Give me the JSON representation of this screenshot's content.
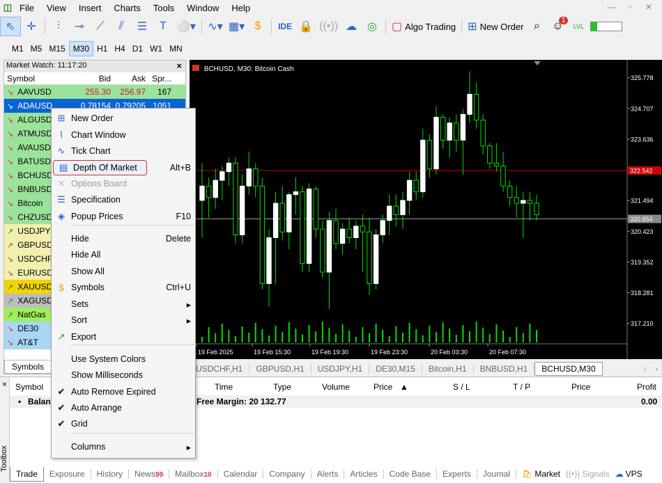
{
  "menubar": {
    "items": [
      "File",
      "View",
      "Insert",
      "Charts",
      "Tools",
      "Window",
      "Help"
    ],
    "window_controls": "— ▫ ✕"
  },
  "toolbar": {
    "ide_label": "IDE",
    "algo_trading_label": "Algo Trading",
    "new_order_label": "New Order",
    "notification_count": "1",
    "level_label": "LVL"
  },
  "timeframes": [
    "M1",
    "M5",
    "M15",
    "M30",
    "H1",
    "H4",
    "D1",
    "W1",
    "MN"
  ],
  "timeframe_selected": "M30",
  "market_watch": {
    "title": "Market Watch: 11:17:20",
    "close": "×",
    "headers": {
      "symbol": "Symbol",
      "bid": "Bid",
      "ask": "Ask",
      "spread": "Spr..."
    },
    "rows": [
      {
        "symbol": "AAVUSD",
        "bid": "255.30",
        "ask": "256.97",
        "spread": "167",
        "bg": "#9be39b",
        "arrow": "↘"
      },
      {
        "symbol": "ADAUSD",
        "bid": "0.78154",
        "ask": "0.79205",
        "spread": "1051",
        "bg": "#0a64d2",
        "arrow": "↘"
      },
      {
        "symbol": "ALGUSD",
        "bid": "",
        "ask": "",
        "spread": "",
        "bg": "#9be39b",
        "arrow": "↘"
      },
      {
        "symbol": "ATMUSD",
        "bid": "",
        "ask": "",
        "spread": "",
        "bg": "#9be39b",
        "arrow": "↘"
      },
      {
        "symbol": "AVAUSD",
        "bid": "",
        "ask": "",
        "spread": "",
        "bg": "#9be39b",
        "arrow": "↘"
      },
      {
        "symbol": "BATUSD",
        "bid": "",
        "ask": "",
        "spread": "",
        "bg": "#9be39b",
        "arrow": "↘"
      },
      {
        "symbol": "BCHUSD",
        "bid": "",
        "ask": "",
        "spread": "",
        "bg": "#9be39b",
        "arrow": "↘"
      },
      {
        "symbol": "BNBUSD",
        "bid": "",
        "ask": "",
        "spread": "",
        "bg": "#9be39b",
        "arrow": "↘"
      },
      {
        "symbol": "Bitcoin",
        "bid": "",
        "ask": "",
        "spread": "",
        "bg": "#9be39b",
        "arrow": "↘"
      },
      {
        "symbol": "CHZUSD",
        "bid": "",
        "ask": "",
        "spread": "",
        "bg": "#9be39b",
        "arrow": "↘"
      },
      {
        "symbol": "USDJPY",
        "bid": "",
        "ask": "",
        "spread": "",
        "bg": "#f3efb0",
        "arrow": "↗"
      },
      {
        "symbol": "GBPUSD",
        "bid": "",
        "ask": "",
        "spread": "",
        "bg": "#f3efb0",
        "arrow": "↗"
      },
      {
        "symbol": "USDCHF",
        "bid": "",
        "ask": "",
        "spread": "",
        "bg": "#f3efb0",
        "arrow": "↘"
      },
      {
        "symbol": "EURUSD",
        "bid": "",
        "ask": "",
        "spread": "",
        "bg": "#f3efb0",
        "arrow": "↘"
      },
      {
        "symbol": "XAUUSD",
        "bid": "",
        "ask": "",
        "spread": "",
        "bg": "#f3d400",
        "arrow": "↗"
      },
      {
        "symbol": "XAGUSD",
        "bid": "",
        "ask": "",
        "spread": "",
        "bg": "#bdbdbd",
        "arrow": "↗"
      },
      {
        "symbol": "NatGas",
        "bid": "",
        "ask": "",
        "spread": "",
        "bg": "#9fee5a",
        "arrow": "↗"
      },
      {
        "symbol": "DE30",
        "bid": "",
        "ask": "",
        "spread": "",
        "bg": "#a9d6f5",
        "arrow": "↘"
      },
      {
        "symbol": "AT&T",
        "bid": "",
        "ask": "",
        "spread": "",
        "bg": "#a9d6f5",
        "arrow": "↘"
      }
    ],
    "tab_label": "Symbols"
  },
  "chart": {
    "title": "BCHUSD, M30:  Bitcoin Cash",
    "price_labels": [
      "325.778",
      "324.707",
      "323.636",
      "322.542",
      "321.494",
      "320.854",
      "320.423",
      "319.352",
      "318.281",
      "317.210"
    ],
    "time_labels": [
      "19 Feb 2025",
      "19 Feb 15:30",
      "19 Feb 19:30",
      "19 Feb 23:30",
      "20 Feb 03:30",
      "20 Feb 07:30"
    ],
    "ask_line_label": "322.542",
    "bid_line_label": "320.854",
    "colors": {
      "bull": "#ffffff",
      "bear": "#000000",
      "wick": "#00e000",
      "ask_line": "#cc0000",
      "bid_line": "#9a9a9a"
    }
  },
  "chart_tabs": [
    "USDCHF,H1",
    "GBPUSD,H1",
    "USDJPY,H1",
    "DE30,M15",
    "Bitcoin,H1",
    "BNBUSD,H1",
    "BCHUSD,M30"
  ],
  "chart_tab_active": "BCHUSD,M30",
  "toolbox": {
    "close": "×",
    "side_label": "Toolbox",
    "columns": [
      "Symbol",
      "Time",
      "Type",
      "Volume",
      "Price",
      "S / L",
      "T / P",
      "Price",
      "Profit"
    ],
    "balance_label": "Balan",
    "free_margin": "Free Margin: 20 132.77",
    "profit_total": "0.00",
    "tabs": [
      {
        "label": "Trade",
        "badge": ""
      },
      {
        "label": "Exposure",
        "badge": ""
      },
      {
        "label": "History",
        "badge": ""
      },
      {
        "label": "News",
        "badge": "99"
      },
      {
        "label": "Mailbox",
        "badge": "10"
      },
      {
        "label": "Calendar",
        "badge": ""
      },
      {
        "label": "Company",
        "badge": ""
      },
      {
        "label": "Alerts",
        "badge": ""
      },
      {
        "label": "Articles",
        "badge": ""
      },
      {
        "label": "Code Base",
        "badge": ""
      },
      {
        "label": "Experts",
        "badge": ""
      },
      {
        "label": "Journal",
        "badge": ""
      }
    ],
    "market_label": "Market",
    "signals_label": "Signals",
    "vps_label": "VPS"
  },
  "context_menu": {
    "items": [
      {
        "label": "New Order",
        "shortcut": "",
        "icon": "new-order-icon",
        "glyph": "⊞"
      },
      {
        "label": "Chart Window",
        "shortcut": "",
        "icon": "chart-window-icon",
        "glyph": "⌇"
      },
      {
        "label": "Tick Chart",
        "shortcut": "",
        "icon": "tick-chart-icon",
        "glyph": "∿"
      },
      {
        "label": "Depth Of Market",
        "shortcut": "Alt+B",
        "icon": "depth-of-market-icon",
        "glyph": "▤"
      },
      {
        "label": "Options Board",
        "shortcut": "",
        "icon": "options-board-icon",
        "glyph": "✕"
      },
      {
        "label": "Specification",
        "shortcut": "",
        "icon": "specification-icon",
        "glyph": "☰"
      },
      {
        "label": "Popup Prices",
        "shortcut": "F10",
        "icon": "popup-prices-icon",
        "glyph": "◈"
      },
      {
        "label": "Hide",
        "shortcut": "Delete",
        "icon": "",
        "glyph": ""
      },
      {
        "label": "Hide All",
        "shortcut": "",
        "icon": "",
        "glyph": ""
      },
      {
        "label": "Show All",
        "shortcut": "",
        "icon": "",
        "glyph": ""
      },
      {
        "label": "Symbols",
        "shortcut": "Ctrl+U",
        "icon": "symbols-icon",
        "glyph": "$"
      },
      {
        "label": "Sets",
        "shortcut": "▸",
        "icon": "",
        "glyph": ""
      },
      {
        "label": "Sort",
        "shortcut": "▸",
        "icon": "",
        "glyph": ""
      },
      {
        "label": "Export",
        "shortcut": "",
        "icon": "export-icon",
        "glyph": "↗"
      },
      {
        "label": "Use System Colors",
        "shortcut": "",
        "icon": "",
        "glyph": ""
      },
      {
        "label": "Show Milliseconds",
        "shortcut": "",
        "icon": "",
        "glyph": ""
      },
      {
        "label": "Auto Remove Expired",
        "shortcut": "",
        "icon": "check-icon",
        "glyph": "✔"
      },
      {
        "label": "Auto Arrange",
        "shortcut": "",
        "icon": "check-icon",
        "glyph": "✔"
      },
      {
        "label": "Grid",
        "shortcut": "",
        "icon": "check-icon",
        "glyph": "✔"
      },
      {
        "label": "Columns",
        "shortcut": "▸",
        "icon": "",
        "glyph": ""
      }
    ]
  },
  "chart_data": {
    "type": "candlestick",
    "symbol": "BCHUSD",
    "timeframe": "M30",
    "ylim": [
      316.5,
      326.4
    ],
    "ask": 322.542,
    "bid": 320.854,
    "candles": [
      [
        321.5,
        322.8,
        320.2,
        322.0
      ],
      [
        322.0,
        322.3,
        320.9,
        321.6
      ],
      [
        321.6,
        322.6,
        321.2,
        322.2
      ],
      [
        322.2,
        322.7,
        321.5,
        322.5
      ],
      [
        322.5,
        323.0,
        322.0,
        322.8
      ],
      [
        322.8,
        323.0,
        320.0,
        320.3
      ],
      [
        320.3,
        322.4,
        320.0,
        322.0
      ],
      [
        322.0,
        323.2,
        321.7,
        322.6
      ],
      [
        322.6,
        322.8,
        321.6,
        322.0
      ],
      [
        322.0,
        322.3,
        318.4,
        318.6
      ],
      [
        318.6,
        320.5,
        317.8,
        320.2
      ],
      [
        320.2,
        321.8,
        318.6,
        321.4
      ],
      [
        321.4,
        322.0,
        320.1,
        320.4
      ],
      [
        320.4,
        321.8,
        319.8,
        321.7
      ],
      [
        321.7,
        322.3,
        321.0,
        321.8
      ],
      [
        321.8,
        322.0,
        319.0,
        319.3
      ],
      [
        319.3,
        322.1,
        319.0,
        321.9
      ],
      [
        321.9,
        322.0,
        320.2,
        320.5
      ],
      [
        320.5,
        320.8,
        318.8,
        319.0
      ],
      [
        319.0,
        321.1,
        317.7,
        320.8
      ],
      [
        320.8,
        321.2,
        319.8,
        320.0
      ],
      [
        320.0,
        320.7,
        319.6,
        320.5
      ],
      [
        320.5,
        320.9,
        320.0,
        320.2
      ],
      [
        320.2,
        320.8,
        319.8,
        320.6
      ],
      [
        320.6,
        321.0,
        319.0,
        320.4
      ],
      [
        320.4,
        320.9,
        318.2,
        318.6
      ],
      [
        318.6,
        320.5,
        318.4,
        320.3
      ],
      [
        320.3,
        321.0,
        320.0,
        320.8
      ],
      [
        320.8,
        321.7,
        320.3,
        321.3
      ],
      [
        321.3,
        321.7,
        320.6,
        321.0
      ],
      [
        321.0,
        321.8,
        320.5,
        321.5
      ],
      [
        321.5,
        322.5,
        321.0,
        322.2
      ],
      [
        322.2,
        322.5,
        321.5,
        321.8
      ],
      [
        321.8,
        324.0,
        321.6,
        323.6
      ],
      [
        323.6,
        323.8,
        322.3,
        322.6
      ],
      [
        322.6,
        324.8,
        322.4,
        324.4
      ],
      [
        324.4,
        324.5,
        323.3,
        323.6
      ],
      [
        323.6,
        324.4,
        323.0,
        324.2
      ],
      [
        324.2,
        324.5,
        323.2,
        323.6
      ],
      [
        323.6,
        324.7,
        322.4,
        324.5
      ],
      [
        324.5,
        326.0,
        324.2,
        325.2
      ],
      [
        325.2,
        325.6,
        324.0,
        324.3
      ],
      [
        324.3,
        324.5,
        323.1,
        323.4
      ],
      [
        323.4,
        323.5,
        322.6,
        322.8
      ],
      [
        322.8,
        323.5,
        322.5,
        322.7
      ],
      [
        322.7,
        323.2,
        321.8,
        322.0
      ],
      [
        322.0,
        322.2,
        321.3,
        321.6
      ],
      [
        321.6,
        322.0,
        320.9,
        321.4
      ],
      [
        321.4,
        321.8,
        320.2,
        321.5
      ],
      [
        321.5,
        321.8,
        320.8,
        321.4
      ],
      [
        321.4,
        321.7,
        320.8,
        321.0
      ]
    ]
  }
}
